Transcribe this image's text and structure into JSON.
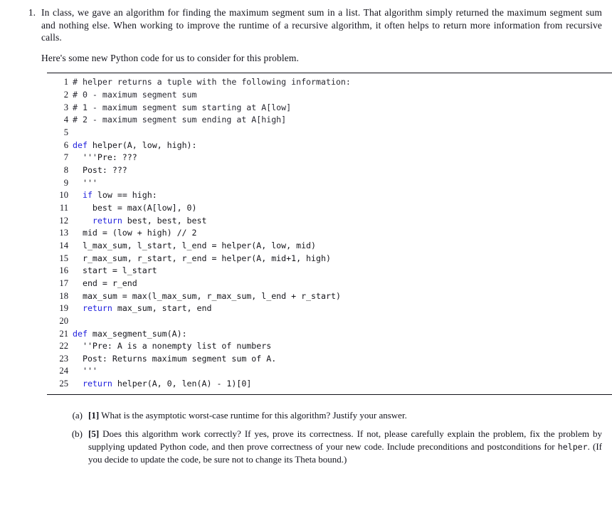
{
  "document": {
    "problem_number": "1.",
    "paragraphs": [
      "In class, we gave an algorithm for finding the maximum segment sum in a list. That algorithm simply returned the maximum segment sum and nothing else. When working to improve the runtime of a recursive algorithm, it often helps to return more information from recursive calls.",
      "Here's some new Python code for us to consider for this problem."
    ]
  },
  "code": {
    "language": "python",
    "colors": {
      "keyword": "#1d1ddd",
      "comment": "#2a2a33",
      "text": "#16161c"
    },
    "lines": [
      {
        "n": "1",
        "tokens": [
          {
            "t": "cmt",
            "s": "# helper returns a tuple with the following information:"
          }
        ]
      },
      {
        "n": "2",
        "tokens": [
          {
            "t": "cmt",
            "s": "# 0 - maximum segment sum"
          }
        ]
      },
      {
        "n": "3",
        "tokens": [
          {
            "t": "cmt",
            "s": "# 1 - maximum segment sum starting at A[low]"
          }
        ]
      },
      {
        "n": "4",
        "tokens": [
          {
            "t": "cmt",
            "s": "# 2 - maximum segment sum ending at A[high]"
          }
        ]
      },
      {
        "n": "5",
        "tokens": []
      },
      {
        "n": "6",
        "tokens": [
          {
            "t": "kw",
            "s": "def"
          },
          {
            "t": "src",
            "s": " helper(A, low, high):"
          }
        ]
      },
      {
        "n": "7",
        "tokens": [
          {
            "t": "src",
            "s": "  '''Pre: ???"
          }
        ]
      },
      {
        "n": "8",
        "tokens": [
          {
            "t": "src",
            "s": "  Post: ???"
          }
        ]
      },
      {
        "n": "9",
        "tokens": [
          {
            "t": "src",
            "s": "  '''"
          }
        ]
      },
      {
        "n": "10",
        "tokens": [
          {
            "t": "src",
            "s": "  "
          },
          {
            "t": "kw",
            "s": "if"
          },
          {
            "t": "src",
            "s": " low == high:"
          }
        ]
      },
      {
        "n": "11",
        "tokens": [
          {
            "t": "src",
            "s": "    best = max(A[low], 0)"
          }
        ]
      },
      {
        "n": "12",
        "tokens": [
          {
            "t": "src",
            "s": "    "
          },
          {
            "t": "kw",
            "s": "return"
          },
          {
            "t": "src",
            "s": " best, best, best"
          }
        ]
      },
      {
        "n": "13",
        "tokens": [
          {
            "t": "src",
            "s": "  mid = (low + high) // 2"
          }
        ]
      },
      {
        "n": "14",
        "tokens": [
          {
            "t": "src",
            "s": "  l_max_sum, l_start, l_end = helper(A, low, mid)"
          }
        ]
      },
      {
        "n": "15",
        "tokens": [
          {
            "t": "src",
            "s": "  r_max_sum, r_start, r_end = helper(A, mid+1, high)"
          }
        ]
      },
      {
        "n": "16",
        "tokens": [
          {
            "t": "src",
            "s": "  start = l_start"
          }
        ]
      },
      {
        "n": "17",
        "tokens": [
          {
            "t": "src",
            "s": "  end = r_end"
          }
        ]
      },
      {
        "n": "18",
        "tokens": [
          {
            "t": "src",
            "s": "  max_sum = max(l_max_sum, r_max_sum, l_end + r_start)"
          }
        ]
      },
      {
        "n": "19",
        "tokens": [
          {
            "t": "src",
            "s": "  "
          },
          {
            "t": "kw",
            "s": "return"
          },
          {
            "t": "src",
            "s": " max_sum, start, end"
          }
        ]
      },
      {
        "n": "20",
        "tokens": []
      },
      {
        "n": "21",
        "tokens": [
          {
            "t": "kw",
            "s": "def"
          },
          {
            "t": "src",
            "s": " max_segment_sum(A):"
          }
        ]
      },
      {
        "n": "22",
        "tokens": [
          {
            "t": "src",
            "s": "  ''Pre: A is a nonempty list of numbers"
          }
        ]
      },
      {
        "n": "23",
        "tokens": [
          {
            "t": "src",
            "s": "  Post: Returns maximum segment sum of A."
          }
        ]
      },
      {
        "n": "24",
        "tokens": [
          {
            "t": "src",
            "s": "  '''"
          }
        ]
      },
      {
        "n": "25",
        "tokens": [
          {
            "t": "src",
            "s": "  "
          },
          {
            "t": "kw",
            "s": "return"
          },
          {
            "t": "src",
            "s": " helper(A, 0, len(A) - 1)[0]"
          }
        ]
      }
    ]
  },
  "subquestions": [
    {
      "label": "(a)",
      "marks": "[1]",
      "text": " What is the asymptotic worst-case runtime for this algorithm? Justify your answer."
    },
    {
      "label": "(b)",
      "marks": "[5]",
      "text_before_mono": " Does this algorithm work correctly? If yes, prove its correctness. If not, please carefully explain the problem, fix the problem by supplying updated Python code, and then prove correctness of your new code. Include preconditions and postconditions for ",
      "mono": "helper",
      "text_after_mono": ". (If you decide to update the code, be sure not to change its Theta bound.)"
    }
  ]
}
